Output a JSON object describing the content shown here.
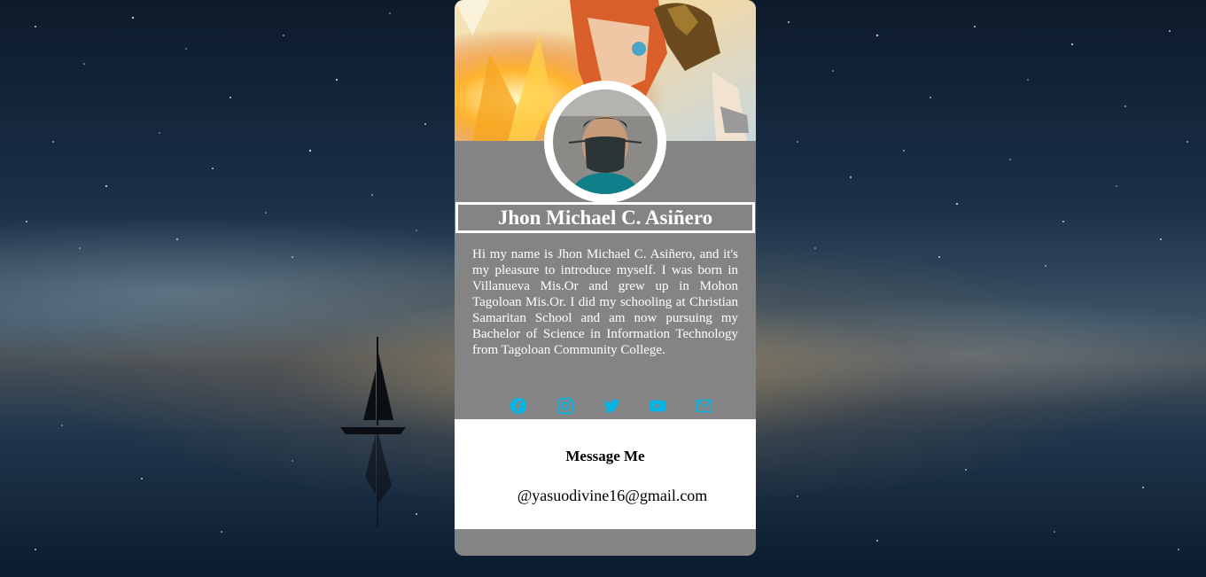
{
  "profile": {
    "name": "Jhon Michael C. Asiñero",
    "bio": "Hi my name is Jhon Michael C. Asiñero, and it's my pleasure to introduce myself. I was born in Villanueva Mis.Or and grew up in Mohon Tagoloan Mis.Or. I did my schooling at Christian Samaritan School and am now pursuing my Bachelor of Science in Information Technology from Tagoloan Community College."
  },
  "socials": [
    {
      "icon": "facebook-icon"
    },
    {
      "icon": "instagram-icon"
    },
    {
      "icon": "twitter-icon"
    },
    {
      "icon": "youtube-icon"
    },
    {
      "icon": "mail-icon"
    }
  ],
  "message": {
    "title": "Message Me",
    "email": "@yasuodivine16@gmail.com"
  },
  "colors": {
    "accent": "#00b4e6",
    "card": "#848484",
    "panel": "#ffffff"
  }
}
